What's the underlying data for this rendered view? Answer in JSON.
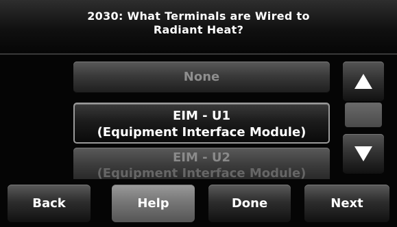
{
  "header": {
    "title_line1": "2030: What Terminals are Wired to",
    "title_line2": "Radiant Heat?"
  },
  "options": [
    {
      "line1": "None",
      "line2": "",
      "state": "dimmed"
    },
    {
      "line1": "EIM - U1",
      "line2": "(Equipment Interface Module)",
      "state": "selected"
    },
    {
      "line1": "EIM - U2",
      "line2": "(Equipment Interface Module)",
      "state": "partially-visible"
    }
  ],
  "scroll": {
    "up_icon": "triangle-up-icon",
    "down_icon": "triangle-down-icon"
  },
  "footer": {
    "back": "Back",
    "help": "Help",
    "done": "Done",
    "next": "Next"
  }
}
